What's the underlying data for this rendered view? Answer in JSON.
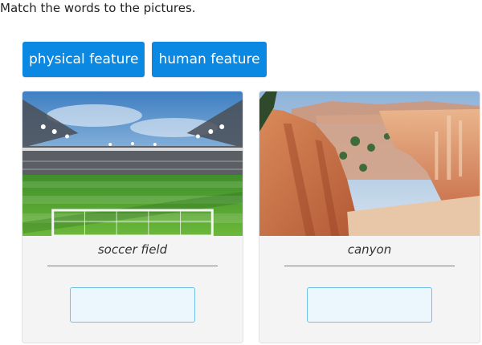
{
  "instructions": "Match the words to the pictures.",
  "word_bank": [
    {
      "label": "physical feature"
    },
    {
      "label": "human feature"
    }
  ],
  "cards": [
    {
      "label": "soccer field",
      "image": "soccer-stadium"
    },
    {
      "label": "canyon",
      "image": "canyon-rock-formations"
    }
  ],
  "colors": {
    "tile_background": "#0b88e2",
    "card_background": "#f4f4f4",
    "rule": "#3a8fd6",
    "drop_target_border": "#6fc1ea",
    "drop_target_fill": "#ecf7fd"
  }
}
